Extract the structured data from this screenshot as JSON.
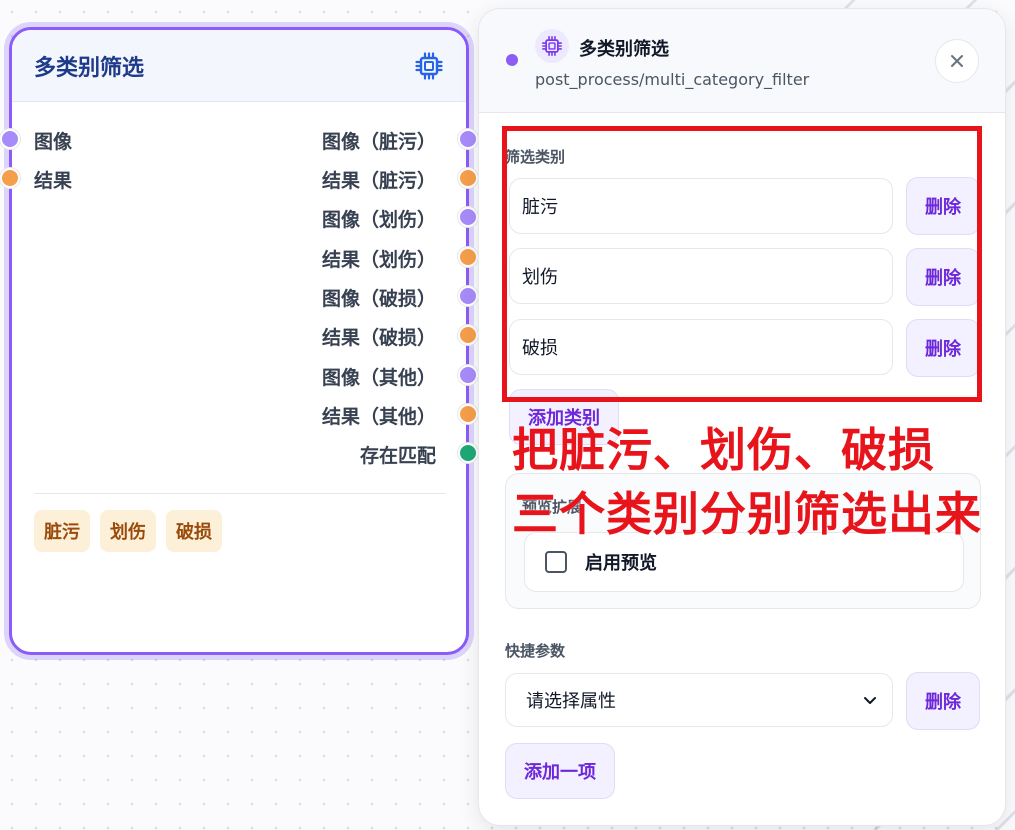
{
  "node": {
    "title": "多类别筛选",
    "title_icon": "chip-icon",
    "inputs": [
      {
        "label": "图像",
        "color": "#a78bfa"
      },
      {
        "label": "结果",
        "color": "#f59e4b"
      }
    ],
    "outputs": [
      {
        "label": "图像（脏污）",
        "color": "#a78bfa"
      },
      {
        "label": "结果（脏污）",
        "color": "#f59e4b"
      },
      {
        "label": "图像（划伤）",
        "color": "#a78bfa"
      },
      {
        "label": "结果（划伤）",
        "color": "#f59e4b"
      },
      {
        "label": "图像（破损）",
        "color": "#a78bfa"
      },
      {
        "label": "结果（破损）",
        "color": "#f59e4b"
      },
      {
        "label": "图像（其他）",
        "color": "#a78bfa"
      },
      {
        "label": "结果（其他）",
        "color": "#f59e4b"
      },
      {
        "label": "存在匹配",
        "color": "#1fa876"
      }
    ],
    "tags": [
      "脏污",
      "划伤",
      "破损"
    ]
  },
  "panel": {
    "title": "多类别筛选",
    "path": "post_process/multi_category_filter",
    "filter_label": "筛选类别",
    "categories": [
      "脏污",
      "划伤",
      "破损"
    ],
    "delete_label": "删除",
    "add_category_label": "添加类别",
    "preview_label": "预览扩展",
    "enable_preview_label": "启用预览",
    "shortcut_label": "快捷参数",
    "select_placeholder": "请选择属性",
    "add_item_label": "添加一项"
  },
  "annotation": {
    "line1": "把脏污、划伤、破损",
    "line2": "三个类别分别筛选出来",
    "color": "#e8141b"
  },
  "theme": {
    "accent": "#8b5cf6",
    "title_color": "#1e3a8a"
  }
}
